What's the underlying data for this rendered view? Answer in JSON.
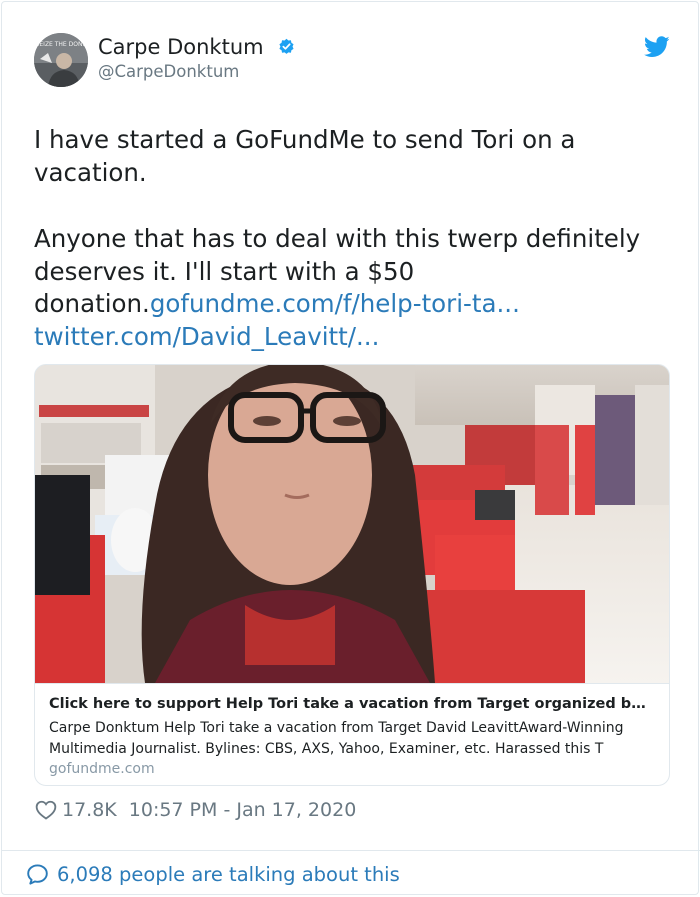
{
  "author": {
    "display_name": "Carpe Donktum",
    "handle": "@CarpeDonktum",
    "avatar_text": "SEIZE THE DONK",
    "verified_icon": "verified-badge-icon"
  },
  "platform_icon": "twitter-bird-icon",
  "tweet": {
    "paragraph_1": "I have started a GoFundMe to send Tori on a vacation.",
    "paragraph_2": "Anyone that has to deal with this twerp definitely deserves it. I'll start with a $50 donation.",
    "link_1": "gofundme.com/f/help-tori-ta...",
    "link_2": "twitter.com/David_Leavitt/..."
  },
  "card": {
    "title": "Click here to support Help Tori take a vacation from Target organized by C...",
    "description": "Carpe Donktum Help Tori take a vacation from Target David LeavittAward-Winning Multimedia Journalist. Bylines: CBS, AXS, Yahoo, Examiner, etc. Harassed this T",
    "domain": "gofundme.com"
  },
  "meta": {
    "likes": "17.8K",
    "timestamp": "10:57 PM - Jan 17, 2020"
  },
  "footer": {
    "talking": "6,098 people are talking about this"
  },
  "colors": {
    "link": "#2b7bb9",
    "muted": "#697882",
    "verified": "#1da1f2",
    "border": "#e1e8ed"
  }
}
